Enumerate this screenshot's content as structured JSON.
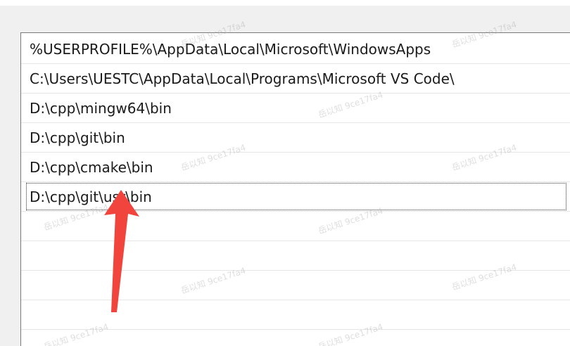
{
  "path_list": {
    "items": [
      {
        "label": "%USERPROFILE%\\AppData\\Local\\Microsoft\\WindowsApps",
        "selected": false
      },
      {
        "label": "C:\\Users\\UESTC\\AppData\\Local\\Programs\\Microsoft VS Code\\",
        "selected": false
      },
      {
        "label": "D:\\cpp\\mingw64\\bin",
        "selected": false
      },
      {
        "label": "D:\\cpp\\git\\bin",
        "selected": false
      },
      {
        "label": "D:\\cpp\\cmake\\bin",
        "selected": false
      },
      {
        "label": "D:\\cpp\\git\\usr\\bin",
        "selected": true
      }
    ]
  },
  "watermark_text": "岳以知 9ce17fa4",
  "annotation": {
    "arrow_color": "#f0443c"
  }
}
